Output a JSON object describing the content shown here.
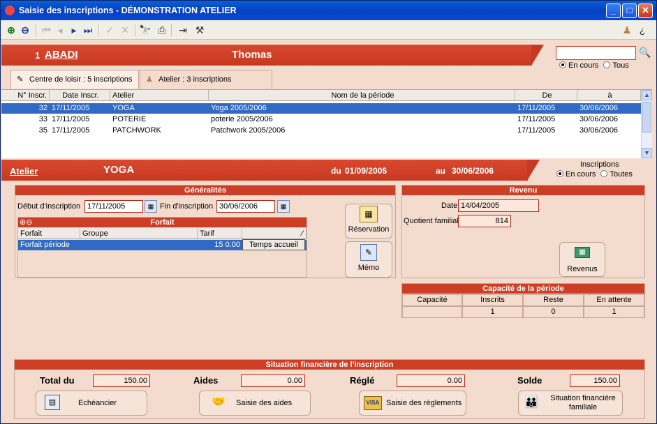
{
  "window": {
    "title": "Saisie des inscriptions - DÉMONSTRATION ATELIER"
  },
  "person": {
    "number": "1",
    "lastname": "ABADI",
    "firstname": "Thomas"
  },
  "filter": {
    "search_value": "",
    "opt_current": "En cours",
    "opt_all": "Tous"
  },
  "tabs": [
    {
      "label": "Centre de loisir : 5 inscriptions"
    },
    {
      "label": "Atelier : 3 inscriptions"
    }
  ],
  "table": {
    "headers": [
      "N° Inscr.",
      "Date Inscr.",
      "Atelier",
      "Nom de la période",
      "De",
      "à"
    ],
    "rows": [
      {
        "num": "32",
        "date": "17/11/2005",
        "atelier": "YOGA",
        "periode": "Yoga 2005/2006",
        "de": "17/11/2005",
        "a": "30/06/2006"
      },
      {
        "num": "33",
        "date": "17/11/2005",
        "atelier": "POTERIE",
        "periode": "poterie 2005/2006",
        "de": "17/11/2005",
        "a": "30/06/2006"
      },
      {
        "num": "35",
        "date": "17/11/2005",
        "atelier": "PATCHWORK",
        "periode": "Patchwork 2005/2006",
        "de": "17/11/2005",
        "a": "30/06/2006"
      }
    ]
  },
  "atelier": {
    "link": "Atelier",
    "name": "YOGA",
    "du_label": "du",
    "du": "01/09/2005",
    "au_label": "au",
    "au": "30/06/2006",
    "insc_label": "Inscriptions",
    "insc_current": "En cours",
    "insc_all": "Toutes"
  },
  "generalites": {
    "title": "Généralités",
    "debut_label": "Début d'inscription",
    "debut": "17/11/2005",
    "fin_label": "Fin d'inscription",
    "fin": "30/06/2006"
  },
  "forfait": {
    "title": "Forfait",
    "headers": [
      "Forfait",
      "Groupe",
      "Tarif",
      ""
    ],
    "rows": [
      {
        "forfait": "Forfait période",
        "groupe": "",
        "tarif": "15 0.00",
        "action": "Temps accueil"
      }
    ]
  },
  "side_buttons": {
    "reservation": "Réservation",
    "memo": "Mémo"
  },
  "revenu": {
    "title": "Revenu",
    "date_label": "Date",
    "date": "14/04/2005",
    "qf_label": "Quotient familial",
    "qf": "814",
    "button": "Revenus"
  },
  "capacite": {
    "title": "Capacité de la période",
    "headers": [
      "Capacité",
      "Inscrits",
      "Reste",
      "En attente"
    ],
    "values": [
      "",
      "1",
      "0",
      "1"
    ]
  },
  "finance": {
    "title": "Situation financière de l'inscription",
    "total_label": "Total du",
    "total": "150.00",
    "aides_label": "Aides",
    "aides": "0.00",
    "regle_label": "Réglé",
    "regle": "0.00",
    "solde_label": "Solde",
    "solde": "150.00",
    "btn_echeancier": "Echéancier",
    "btn_aides": "Saisie des aides",
    "btn_reglements": "Saisie des règlements",
    "btn_situation_l1": "Situation financière",
    "btn_situation_l2": "familiale"
  },
  "colors": {
    "accent_red": "#cc3f26",
    "selection_blue": "#316ac5",
    "title_blue": "#0a4ad0"
  }
}
